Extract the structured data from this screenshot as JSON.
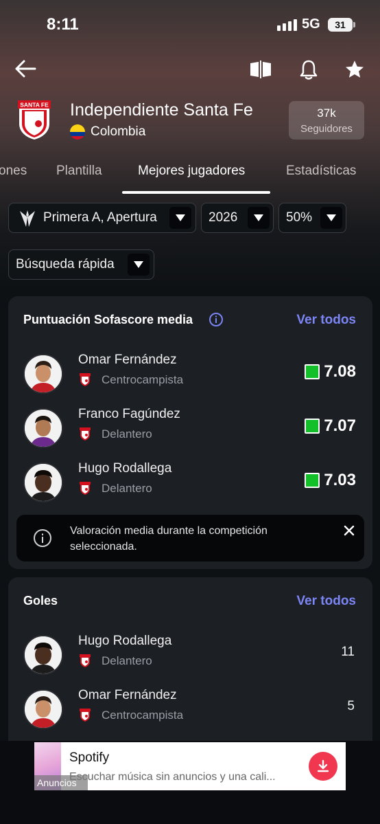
{
  "status_bar": {
    "time": "8:11",
    "network": "5G",
    "battery": "31"
  },
  "team": {
    "name": "Independiente Santa Fe",
    "country": "Colombia",
    "followers_count": "37k",
    "followers_label": "Seguidores",
    "crest_text": "SANTA FE"
  },
  "tabs": [
    {
      "label": "ones"
    },
    {
      "label": "Plantilla"
    },
    {
      "label": "Mejores jugadores"
    },
    {
      "label": "Estadísticas"
    }
  ],
  "filters": {
    "competition": "Primera A, Apertura",
    "season": "2026",
    "percent": "50%",
    "quick_search": "Búsqueda rápida"
  },
  "rating_card": {
    "title": "Puntuación Sofascore media",
    "see_all": "Ver todos",
    "players": [
      {
        "name": "Omar Fernández",
        "position": "Centrocampista",
        "rating": "7.08"
      },
      {
        "name": "Franco Fagúndez",
        "position": "Delantero",
        "rating": "7.07"
      },
      {
        "name": "Hugo Rodallega",
        "position": "Delantero",
        "rating": "7.03"
      }
    ],
    "info": "Valoración media durante la competición seleccionada.",
    "rating_color": "#13c02a"
  },
  "goals_card": {
    "title": "Goles",
    "see_all": "Ver todos",
    "players": [
      {
        "name": "Hugo Rodallega",
        "position": "Delantero",
        "value": "11"
      },
      {
        "name": "Omar Fernández",
        "position": "Centrocampista",
        "value": "5"
      }
    ]
  },
  "ad": {
    "title": "Spotify",
    "subtitle": "Escuchar música sin anuncios y una cali...",
    "label": "Anuncios",
    "accent": "#f0374f"
  },
  "colors": {
    "accent": "#7c85f5",
    "card": "#1c1f23",
    "background": "#0e1114"
  }
}
